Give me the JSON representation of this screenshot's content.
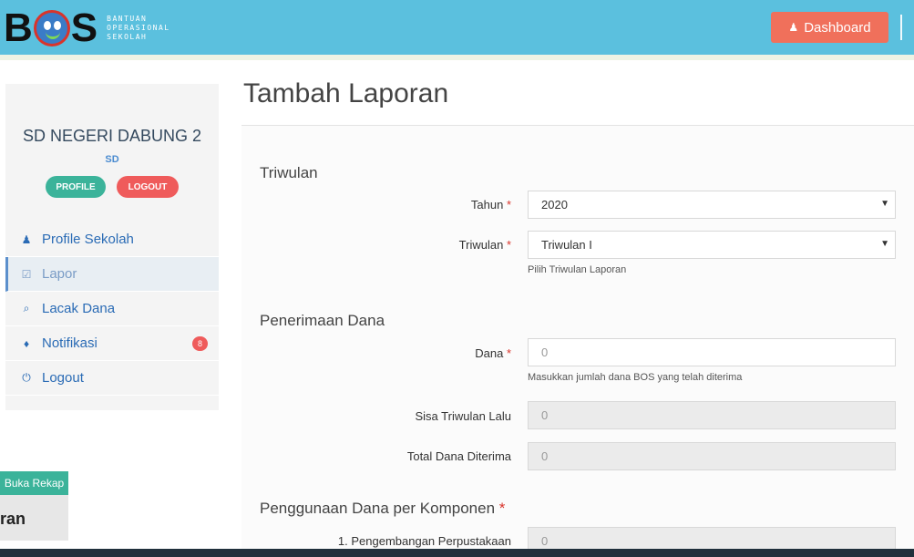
{
  "header": {
    "logo_letters": [
      "B",
      "S"
    ],
    "logo_subtitle": [
      "BANTUAN",
      "OPERASIONAL",
      "SEKOLAH"
    ],
    "dashboard_label": "Dashboard",
    "dashboard_color": "#f0705b",
    "bar_color": "#5bc0de"
  },
  "sidebar": {
    "school_name": "SD NEGERI DABUNG 2",
    "school_level": "SD",
    "profile_label": "PROFILE",
    "logout_pill_label": "LOGOUT",
    "items": [
      {
        "label": "Profile Sekolah",
        "icon": "user-icon",
        "active": false
      },
      {
        "label": "Lapor",
        "icon": "checkbox-icon",
        "active": true
      },
      {
        "label": "Lacak Dana",
        "icon": "zoom-icon",
        "active": false
      },
      {
        "label": "Notifikasi",
        "icon": "bell-icon",
        "active": false,
        "badge": "8"
      },
      {
        "label": "Logout",
        "icon": "power-icon",
        "active": false
      }
    ]
  },
  "floating": {
    "rekap_label": "Buka Rekap",
    "partial_text": "ran"
  },
  "main": {
    "title": "Tambah Laporan",
    "sections": {
      "triwulan": "Triwulan",
      "penerimaan": "Penerimaan Dana",
      "penggunaan": "Penggunaan Dana per Komponen"
    },
    "required_mark": "*",
    "fields": {
      "tahun": {
        "label": "Tahun",
        "value": "2020"
      },
      "triwulan": {
        "label": "Triwulan",
        "value": "Triwulan I",
        "help": "Pilih Triwulan Laporan"
      },
      "dana": {
        "label": "Dana",
        "placeholder": "0",
        "help": "Masukkan jumlah dana BOS yang telah diterima"
      },
      "sisa": {
        "label": "Sisa Triwulan Lalu",
        "value": "0"
      },
      "total": {
        "label": "Total Dana Diterima",
        "value": "0"
      },
      "komponen1": {
        "label": "1. Pengembangan Perpustakaan",
        "value": "0"
      }
    }
  }
}
